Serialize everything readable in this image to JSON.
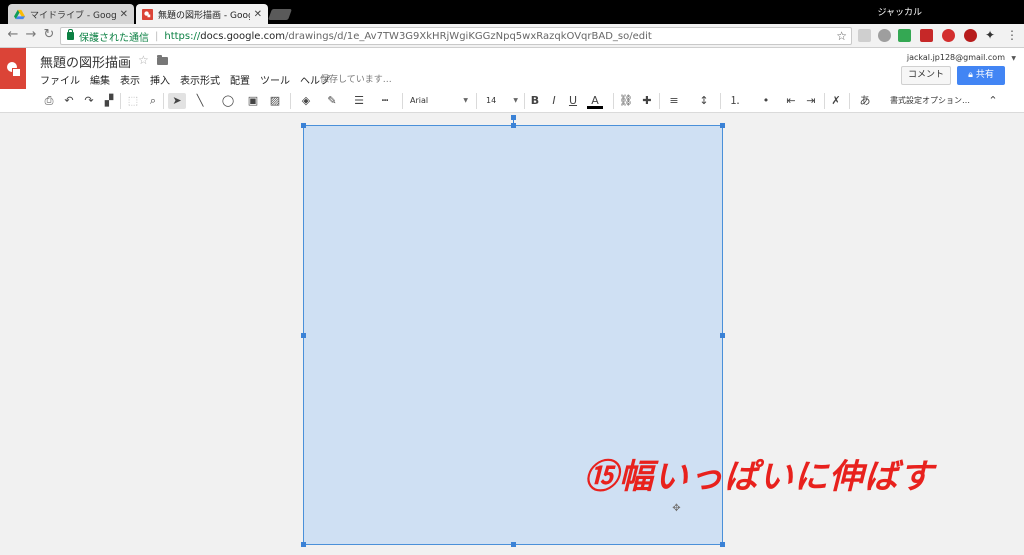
{
  "browser": {
    "tabs": [
      {
        "title": "マイドライブ - Google ドライブ",
        "active": false
      },
      {
        "title": "無題の図形描画 - Google",
        "active": true
      }
    ],
    "window_user": "ジャッカル",
    "address": {
      "secure_label": "保護された通信",
      "url_scheme": "https://",
      "url_host": "docs.google.com",
      "url_path": "/drawings/d/1e_Av7TW3G9XkHRjWgiKGGzNpq5wxRazqkOVqrBAD_so/edit"
    }
  },
  "docs": {
    "title": "無題の図形描画",
    "menu": [
      "ファイル",
      "編集",
      "表示",
      "挿入",
      "表示形式",
      "配置",
      "ツール",
      "ヘルプ"
    ],
    "saving_status": "保存しています…",
    "account": "jackal.jp128@gmail.com",
    "comment_label": "コメント",
    "share_label": "共有"
  },
  "toolbar": {
    "font": "Arial",
    "font_size": "14",
    "format_options": "書式設定オプション…",
    "input_tool": "あ"
  },
  "canvas": {
    "shape_fill": "#cfe0f3",
    "shape_border": "#4a90d9",
    "caption": "⑮幅いっぱいに伸ばす"
  },
  "colors": {
    "accent": "#4285f4",
    "app_brand": "#db4437",
    "caption_red": "#e8211d"
  }
}
